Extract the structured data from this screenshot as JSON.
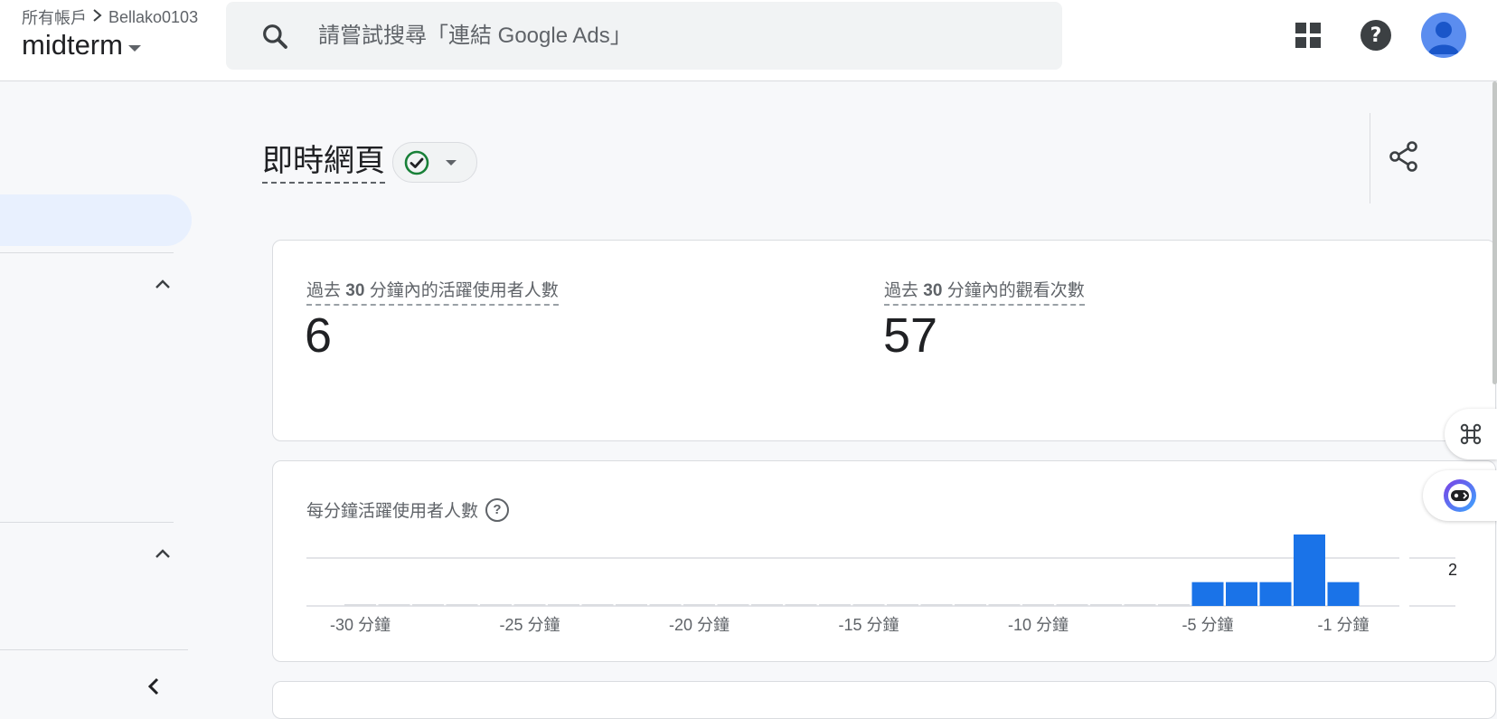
{
  "header": {
    "breadcrumb_root": "所有帳戶",
    "breadcrumb_account": "Bellako0103",
    "property_name": "midterm",
    "search_placeholder": "請嘗試搜尋「連結 Google Ads」"
  },
  "page": {
    "title": "即時網頁"
  },
  "metrics": {
    "active_users_label_pre": "過去 ",
    "active_users_label_num": "30",
    "active_users_label_post": " 分鐘內的活躍使用者人數",
    "active_users_value": "6",
    "views_label_pre": "過去 ",
    "views_label_num": "30",
    "views_label_post": " 分鐘內的觀看次數",
    "views_value": "57"
  },
  "chart_data": {
    "type": "bar",
    "title": "每分鐘活躍使用者人數",
    "x": [
      -30,
      -29,
      -28,
      -27,
      -26,
      -25,
      -24,
      -23,
      -22,
      -21,
      -20,
      -19,
      -18,
      -17,
      -16,
      -15,
      -14,
      -13,
      -12,
      -11,
      -10,
      -9,
      -8,
      -7,
      -6,
      -5,
      -4,
      -3,
      -2,
      -1
    ],
    "values": [
      0,
      0,
      0,
      0,
      0,
      0,
      0,
      0,
      0,
      0,
      0,
      0,
      0,
      0,
      0,
      0,
      0,
      0,
      0,
      0,
      0,
      0,
      0,
      0,
      0,
      1,
      1,
      1,
      3,
      1
    ],
    "tick_labels": [
      "-30 分鐘",
      "-25 分鐘",
      "-20 分鐘",
      "-15 分鐘",
      "-10 分鐘",
      "-5 分鐘",
      "-1 分鐘"
    ],
    "tick_positions": [
      -30,
      -25,
      -20,
      -15,
      -10,
      -5,
      -1
    ],
    "y_label_value": "2",
    "ylim": [
      0,
      3
    ],
    "bar_color": "#1a73e8"
  },
  "colors": {
    "accent": "#1a73e8",
    "status_ok": "#188038"
  }
}
